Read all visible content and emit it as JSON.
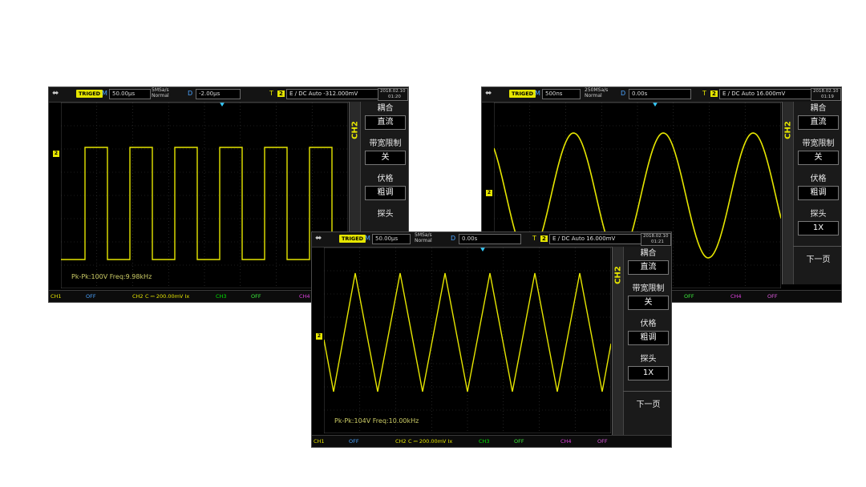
{
  "scopes": [
    {
      "usb": "⬌",
      "trig": "TRIGED",
      "m_label": "M",
      "m_value": "50.00μs",
      "rate": "5MSa/s",
      "mode": "Normal",
      "d_label": "D",
      "d_value": "-2.00μs",
      "t_label": "T",
      "t_ch": "2",
      "t_value": "E / DC Auto -312.000mV",
      "date_line1": "2018.02.10",
      "date_line2": "01:20",
      "measurement": "Pk-Pk:100V   Freq:9.98kHz",
      "bottom": {
        "ch1": "CH1",
        "ch1_off": "OFF",
        "ch2": "CH2",
        "ch2_val": "C ⎓ 200.00mV Ix",
        "ch3": "CH3",
        "ch3_off": "OFF",
        "ch4": "CH4"
      },
      "wave": "square"
    },
    {
      "usb": "⬌",
      "trig": "TRIGED",
      "m_label": "M",
      "m_value": "500ns",
      "rate": "250MSa/s",
      "mode": "Normal",
      "d_label": "D",
      "d_value": "0.00s",
      "t_label": "T",
      "t_ch": "2",
      "t_value": "E / DC Auto 16.000mV",
      "date_line1": "2018.02.10",
      "date_line2": "01:19",
      "bottom": {
        "ch3_off": "OFF",
        "ch4": "CH4",
        "ch4_off": "OFF"
      },
      "wave": "sine"
    },
    {
      "usb": "⬌",
      "trig": "TRIGED",
      "m_label": "M",
      "m_value": "50.00μs",
      "rate": "5MSa/s",
      "mode": "Normal",
      "d_label": "D",
      "d_value": "0.00s",
      "t_label": "T",
      "t_ch": "2",
      "t_value": "E / DC Auto 16.000mV",
      "date_line1": "2018.02.10",
      "date_line2": "01:21",
      "measurement": "Pk-Pk:104V   Freq:10.00kHz",
      "bottom": {
        "ch1": "CH1",
        "ch1_off": "OFF",
        "ch2": "CH2",
        "ch2_val": "C ⎓ 200.00mV Ix",
        "ch3": "CH3",
        "ch3_off": "OFF",
        "ch4": "CH4",
        "ch4_off": "OFF"
      },
      "wave": "triangle"
    }
  ],
  "menu": {
    "channel": "CH2",
    "coupling_label": "耦合",
    "coupling_value": "直流",
    "bw_label": "带宽限制",
    "bw_value": "关",
    "vscale_label": "伏格",
    "vscale_value": "粗调",
    "probe_label": "探头",
    "probe_value": "1X",
    "next_page": "下一页"
  },
  "colors": {
    "trace": "#e6e600",
    "grid": "#3a3a3a",
    "trigger_marker": "#33ccff"
  }
}
